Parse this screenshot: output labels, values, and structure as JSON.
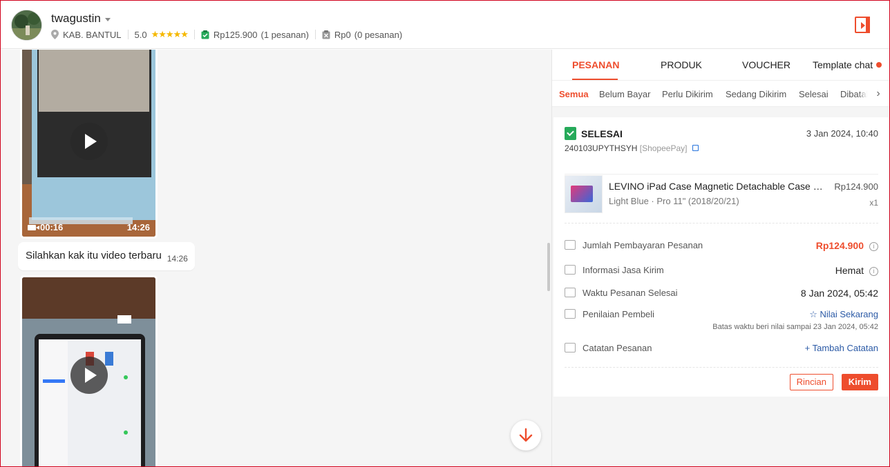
{
  "header": {
    "username": "twagustin",
    "location": "KAB. BANTUL",
    "rating": "5.0",
    "paid_amount": "Rp125.900",
    "paid_orders": "(1 pesanan)",
    "unpaid_amount": "Rp0",
    "unpaid_orders": "(0 pesanan)"
  },
  "chat": {
    "video1": {
      "duration": "00:16",
      "time": "14:26"
    },
    "message": {
      "text": "Silahkan kak itu video terbaru",
      "time": "14:26"
    }
  },
  "panel": {
    "tabs": [
      "PESANAN",
      "PRODUK",
      "VOUCHER",
      "Template chat"
    ],
    "subtabs": [
      "Semua",
      "Belum Bayar",
      "Perlu Dikirim",
      "Sedang Dikirim",
      "Selesai",
      "Dibatalkan"
    ],
    "order": {
      "status": "SELESAI",
      "date": "3 Jan 2024, 10:40",
      "id": "240103UPYTHSYH",
      "payment": "[ShopeePay]",
      "product_name": "LEVINO iPad Case Magnetic Detachable Case Pencil Holder",
      "variation": "Light Blue · Pro 11\" (2018/20/21)",
      "price": "Rp124.900",
      "qty": "x1",
      "payment_label": "Jumlah Pembayaran Pesanan",
      "payment_value": "Rp124.900",
      "shipping_label": "Informasi Jasa Kirim",
      "shipping_value": "Hemat",
      "completed_label": "Waktu Pesanan Selesai",
      "completed_value": "8 Jan 2024, 05:42",
      "review_label": "Penilaian Pembeli",
      "review_value": "☆ Nilai Sekarang",
      "review_note": "Batas waktu beri nilai sampai 23 Jan 2024, 05:42",
      "notes_label": "Catatan Pesanan",
      "notes_value": "+ Tambah Catatan",
      "detail_button": "Rincian",
      "send_button": "Kirim"
    }
  },
  "colors": {
    "accent": "#ee4d2d",
    "success": "#26aa5a",
    "link": "#2b5aa6"
  },
  "icons": {
    "header_action": "side-panel-toggle-icon",
    "scroll_down": "arrow-down-icon"
  }
}
